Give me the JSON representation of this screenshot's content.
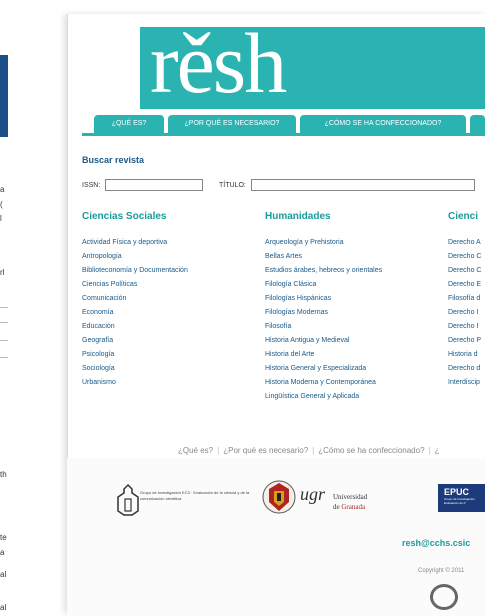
{
  "background_window": {
    "fragments": [
      "a",
      "(",
      "l",
      "rl",
      "th",
      "te",
      "a",
      "al",
      "al"
    ]
  },
  "header": {
    "logo_text": "rěsh",
    "nav_tabs": [
      "¿QUÉ ES?",
      "¿POR QUÉ ES NECESARIO?",
      "¿CÓMO SE HA CONFECCIONADO?"
    ]
  },
  "search": {
    "title": "Buscar revista",
    "issn_label": "ISSN:",
    "titulo_label": "TÍTULO:",
    "issn_value": "",
    "titulo_value": ""
  },
  "columns": [
    {
      "heading": "Ciencias Sociales",
      "items": [
        "Actividad Física y deportiva",
        "Antropología",
        "Biblioteconomía y Documentación",
        "Ciencias Políticas",
        "Comunicación",
        "Economía",
        "Educación",
        "Geografía",
        "Psicología",
        "Sociología",
        "Urbanismo"
      ]
    },
    {
      "heading": "Humanidades",
      "items": [
        "Arqueología y Prehistoria",
        "Bellas Artes",
        "Estudios árabes, hebreos y orientales",
        "Filología Clásica",
        "Filologías Hispánicas",
        "Filologías Modernas",
        "Filosofía",
        "Historia Antigua y Medieval",
        "Historia del Arte",
        "Historia General y Especializada",
        "Historia Moderna y Contemporánea",
        "Lingüística General y Aplicada"
      ]
    },
    {
      "heading": "Cienci",
      "items": [
        "Derecho A",
        "Derecho C",
        "Derecho C",
        "Derecho E",
        "Filosofía d",
        "Derecho I",
        "Derecho I",
        "Derecho P",
        "Historia d",
        "Derecho d",
        "Interdiscip"
      ]
    }
  ],
  "footer": {
    "links": [
      "¿Qué es?",
      "¿Por qué es necesario?",
      "¿Cómo se ha confeccionado?",
      "¿"
    ],
    "grupo_text": "Grupo de investigación EC3 · Evaluación de la ciencia y de la comunicación científica",
    "ugr_text": "ugr",
    "univ_line1": "Universidad",
    "univ_line2": "de",
    "univ_line3": "Granada",
    "epuc_text": "EPUC",
    "epuc_sub": "Grupo de Investigación Evaluación de P",
    "email": "resh@cchs.csic",
    "copyright": "Copyright © 2011"
  },
  "colors": {
    "teal": "#2bb3b1",
    "heading_teal": "#1a9b9a",
    "link_blue": "#1a5a8a",
    "epuc_navy": "#1d3a7a"
  }
}
